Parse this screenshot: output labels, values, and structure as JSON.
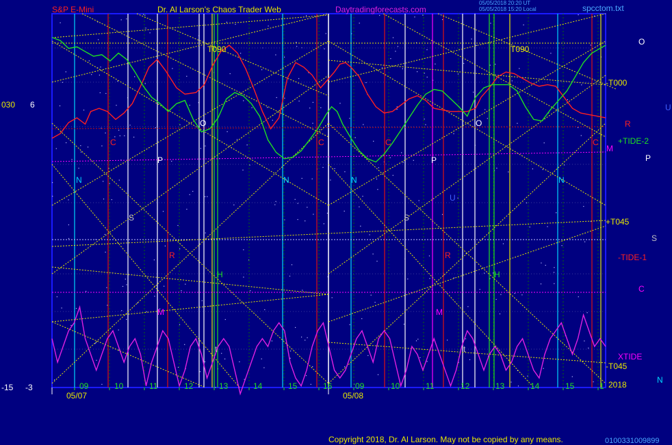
{
  "colors": {
    "background": "#000080",
    "frame": "#1a1aff",
    "price_line": "#ff2020",
    "tide_line": "#20e020",
    "xtide_line": "#e020e0",
    "yellow_lines": "#e8e800",
    "cyan_lines": "#00d8ff",
    "red_lines": "#e01010",
    "magenta_lines": "#ff00ff",
    "white_lines": "#ffffff"
  },
  "header": {
    "instrument": "S&P E-Mini",
    "author": "Dr. Al Larson's Chaos Trader Web",
    "site": "Daytradingforecasts.com",
    "stamp_1": "05/05/2018 20:20 UT",
    "stamp_2": "05/05/2018 15:20 Local",
    "file": "spcctom.txt"
  },
  "axis_left": {
    "top_a": "030",
    "top_b": "6",
    "bottom_a": "-15",
    "bottom_b": "-3"
  },
  "right_labels": {
    "o": "O",
    "t000": "-T000",
    "u": "U",
    "r": "R",
    "tide2": "+TIDE-2",
    "m": "M",
    "p": "P",
    "t045p": "+T045",
    "s": "S",
    "tide1": "-TIDE-1",
    "c": "C",
    "xtide": "XTIDE",
    "t045m": "-T045",
    "year": "2018",
    "n": "N"
  },
  "days": [
    {
      "date": "05/07",
      "hours": [
        "09",
        "10",
        "11",
        "12",
        "13",
        "14",
        "15",
        "16"
      ]
    },
    {
      "date": "05/08",
      "hours": [
        "09",
        "10",
        "11",
        "12",
        "13",
        "14",
        "15",
        "1"
      ]
    }
  ],
  "planet_marks": {
    "t090": "T090",
    "o": "O",
    "c": "C",
    "p": "P",
    "n": "N",
    "s": "S",
    "r": "R",
    "h": "H",
    "m": "M",
    "u": "U",
    "t": "t"
  },
  "footer": {
    "copyright": "Copyright 2018, Dr. Al Larson. May not be copied by any means.",
    "code": "0100331009899"
  },
  "chart_data": {
    "type": "line",
    "series": [
      {
        "name": "TIDE-1",
        "x": [
          0,
          3,
          6,
          9,
          12,
          14,
          17,
          20,
          23,
          26,
          29,
          32,
          35,
          38,
          41,
          45,
          48,
          52,
          55,
          58,
          61,
          64,
          67,
          70,
          73,
          76,
          79,
          82,
          85,
          88,
          91,
          94,
          97,
          99,
          102,
          104,
          106,
          108,
          111,
          114,
          117,
          120,
          123,
          126,
          129,
          132,
          135,
          138,
          141,
          144,
          147,
          150,
          153,
          155,
          158,
          161,
          164,
          167,
          170,
          173,
          176,
          179,
          182,
          185,
          188,
          191,
          194,
          197,
          200
        ],
        "y": [
          0.2,
          0.5,
          1.2,
          1.5,
          1.1,
          1.9,
          2.1,
          1.9,
          1.4,
          1.8,
          2.4,
          3.5,
          4.7,
          5.2,
          4.5,
          3.4,
          3.0,
          3.1,
          3.6,
          4.8,
          5.7,
          6.1,
          5.6,
          4.6,
          3.3,
          1.9,
          0.8,
          1.5,
          4.0,
          5.0,
          4.7,
          4.2,
          3.4,
          3.8,
          4.4,
          4.9,
          5.0,
          4.7,
          4.1,
          3.0,
          2.2,
          1.8,
          1.9,
          2.3,
          2.7,
          2.9,
          2.6,
          2.1,
          2.0,
          1.9,
          1.9,
          1.9,
          2.1,
          2.8,
          3.4,
          4.1,
          4.4,
          4.3,
          4.0,
          3.7,
          3.5,
          3.6,
          3.5,
          2.8,
          2.1,
          1.8,
          1.7,
          1.6,
          1.5
        ]
      },
      {
        "name": "TIDE-2",
        "x": [
          0,
          3,
          6,
          9,
          12,
          15,
          18,
          21,
          24,
          27,
          30,
          33,
          36,
          39,
          42,
          45,
          48,
          51,
          54,
          57,
          60,
          63,
          66,
          69,
          72,
          75,
          78,
          81,
          84,
          87,
          90,
          93,
          96,
          99,
          101,
          103,
          105,
          108,
          111,
          114,
          117,
          120,
          123,
          126,
          129,
          132,
          135,
          138,
          141,
          144,
          147,
          150,
          153,
          156,
          159,
          162,
          165,
          168,
          171,
          174,
          177,
          180,
          183,
          186,
          189,
          192,
          195,
          198,
          200
        ],
        "y": [
          6.6,
          6.4,
          5.9,
          6.0,
          5.7,
          5.4,
          5.5,
          5.1,
          5.6,
          5.2,
          4.4,
          3.5,
          2.8,
          2.4,
          1.9,
          2.4,
          2.6,
          1.4,
          0.6,
          0.8,
          1.5,
          2.7,
          3.1,
          2.9,
          2.4,
          1.6,
          0.1,
          -0.7,
          -1.1,
          -1.0,
          -0.6,
          0.1,
          0.8,
          1.7,
          2.2,
          1.9,
          1.1,
          0.2,
          -0.6,
          -1.1,
          -1.3,
          -0.8,
          -0.1,
          0.7,
          1.5,
          2.3,
          3.0,
          3.3,
          3.2,
          2.7,
          2.2,
          1.6,
          2.8,
          3.4,
          3.6,
          3.6,
          3.6,
          3.2,
          2.2,
          1.4,
          1.3,
          2.0,
          2.6,
          3.2,
          4.1,
          5.0,
          5.6,
          5.9,
          6.1
        ]
      },
      {
        "name": "XTIDE",
        "x": [
          0,
          2,
          4,
          6,
          8,
          10,
          12,
          14,
          16,
          18,
          20,
          22,
          24,
          26,
          28,
          30,
          32,
          34,
          36,
          38,
          40,
          42,
          44,
          46,
          48,
          50,
          52,
          54,
          56,
          58,
          60,
          62,
          64,
          66,
          68,
          70,
          72,
          74,
          76,
          78,
          80,
          82,
          84,
          86,
          88,
          90,
          92,
          94,
          96,
          98,
          100,
          102,
          104,
          106,
          108,
          110,
          112,
          114,
          116,
          118,
          120,
          122,
          124,
          126,
          128,
          130,
          132,
          134,
          136,
          138,
          140,
          142,
          144,
          146,
          148,
          150,
          152,
          154,
          156,
          158,
          160,
          162,
          164,
          166,
          168,
          170,
          172,
          174,
          176,
          178,
          180,
          182,
          184,
          186,
          188,
          190,
          192,
          194,
          196,
          198,
          200
        ],
        "y": [
          -12.5,
          -14,
          -13,
          -12,
          -11.5,
          -10.5,
          -12.5,
          -13.5,
          -14.5,
          -13.5,
          -12.5,
          -12,
          -13,
          -14,
          -13,
          -12.5,
          -13.5,
          -15.5,
          -14,
          -13,
          -12,
          -12.5,
          -14,
          -15.5,
          -14.5,
          -13,
          -12.5,
          -13.5,
          -15,
          -14,
          -13,
          -12.5,
          -13,
          -14.5,
          -16,
          -15,
          -14,
          -13,
          -12.5,
          -13,
          -12,
          -11.5,
          -12,
          -14,
          -15,
          -15.5,
          -14.5,
          -13,
          -12,
          -11.5,
          -13,
          -14.5,
          -15,
          -14.5,
          -13.5,
          -12.5,
          -12,
          -13,
          -14,
          -12.5,
          -12,
          -12.5,
          -14,
          -15.5,
          -14.5,
          -13,
          -13.5,
          -14.5,
          -13.5,
          -12.5,
          -13.5,
          -14.5,
          -15.5,
          -14.5,
          -13,
          -12,
          -12.5,
          -13.5,
          -14.5,
          -13.5,
          -13,
          -13.5,
          -14.5,
          -14,
          -13,
          -12.5,
          -13.5,
          -14.5,
          -15,
          -13.5,
          -12.5,
          -12,
          -11.5,
          -12.5,
          -13.5,
          -12.5,
          -11,
          -12,
          -13,
          -12.5,
          -13
        ]
      }
    ],
    "ylim": [
      -15.6,
      8.1
    ],
    "xlim": [
      0,
      200
    ],
    "grid": true
  }
}
